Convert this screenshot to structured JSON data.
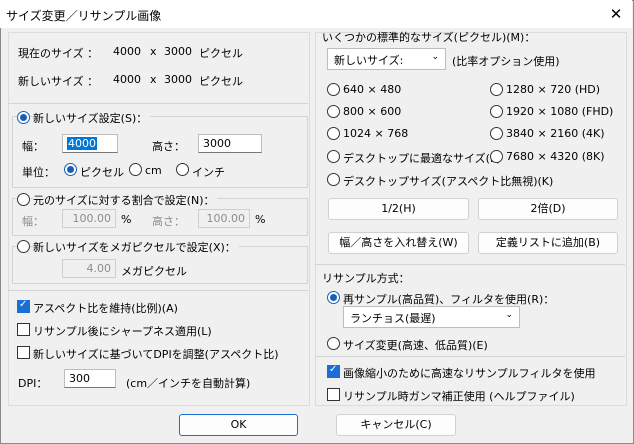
{
  "window": {
    "title": "サイズ変更／リサンプル画像",
    "close_glyph": "✕"
  },
  "info": {
    "current_label": "現在のサイズ ：",
    "current_w": "4000",
    "x1": "x",
    "current_h": "3000",
    "current_unit": "ピクセル",
    "new_label": "新しいサイズ ：",
    "new_w": "4000",
    "x2": "x",
    "new_h": "3000",
    "new_unit": "ピクセル"
  },
  "set_size": {
    "radio_label": "新しいサイズ設定(S)：",
    "width_label": "幅：",
    "width_value": "4000",
    "height_label": "高さ：",
    "height_value": "3000",
    "unit_label": "単位：",
    "units": [
      "ピクセル",
      "cm",
      "インチ"
    ]
  },
  "percent": {
    "radio_label": "元のサイズに対する割合で設定(N)：",
    "width_label": "幅：",
    "width_value": "100.00",
    "width_unit": "%",
    "height_label": "高さ：",
    "height_value": "100.00",
    "height_unit": "%"
  },
  "megapixel": {
    "radio_label": "新しいサイズをメガピクセルで設定(X)：",
    "value": "4.00",
    "unit": "メガピクセル"
  },
  "options": {
    "keep_aspect": "アスペクト比を維持(比例)(A)",
    "sharpen": "リサンプル後にシャープネス適用(L)",
    "adjust_dpi": "新しいサイズに基づいてDPIを調整(アスペクト比)",
    "dpi_label": "DPI：",
    "dpi_value": "300",
    "dpi_note": "(cm／インチを自動計算)"
  },
  "standard": {
    "group_label": "いくつかの標準的なサイズ(ピクセル)(M)：",
    "select_value": "新しいサイズ:",
    "select_note": "(比率オプション使用)",
    "left_sizes": [
      "640 × 480",
      "800 × 600",
      "1024 × 768",
      "デスクトップに最適なサイズ(F)",
      "デスクトップサイズ(アスペクト比無視)(K)"
    ],
    "right_sizes": [
      "1280 × 720 (HD)",
      "1920 × 1080 (FHD)",
      "3840 × 2160 (4K)",
      "7680 × 4320 (8K)"
    ],
    "half_button": "1/2(H)",
    "double_button": "2倍(D)",
    "swap_button": "幅／高さを入れ替え(W)",
    "add_list_button": "定義リストに追加(B)"
  },
  "resample": {
    "group_label": "リサンプル方式：",
    "resample_radio": "再サンプル(高品質)、フィルタを使用(R)：",
    "filter_value": "ランチョス(最遅)",
    "resize_radio": "サイズ変更(高速、低品質)(E)",
    "fast_filter": "画像縮小のために高速なリサンプルフィルタを使用",
    "gamma": "リサンプル時ガンマ補正使用 (ヘルプファイル)"
  },
  "footer": {
    "ok": "OK",
    "cancel": "キャンセル(C)"
  },
  "colors": {
    "accent": "#1a6fd4",
    "selection": "#0078d7"
  },
  "icons": [
    "close-icon",
    "chevron-down-icon",
    "checkmark-icon"
  ]
}
